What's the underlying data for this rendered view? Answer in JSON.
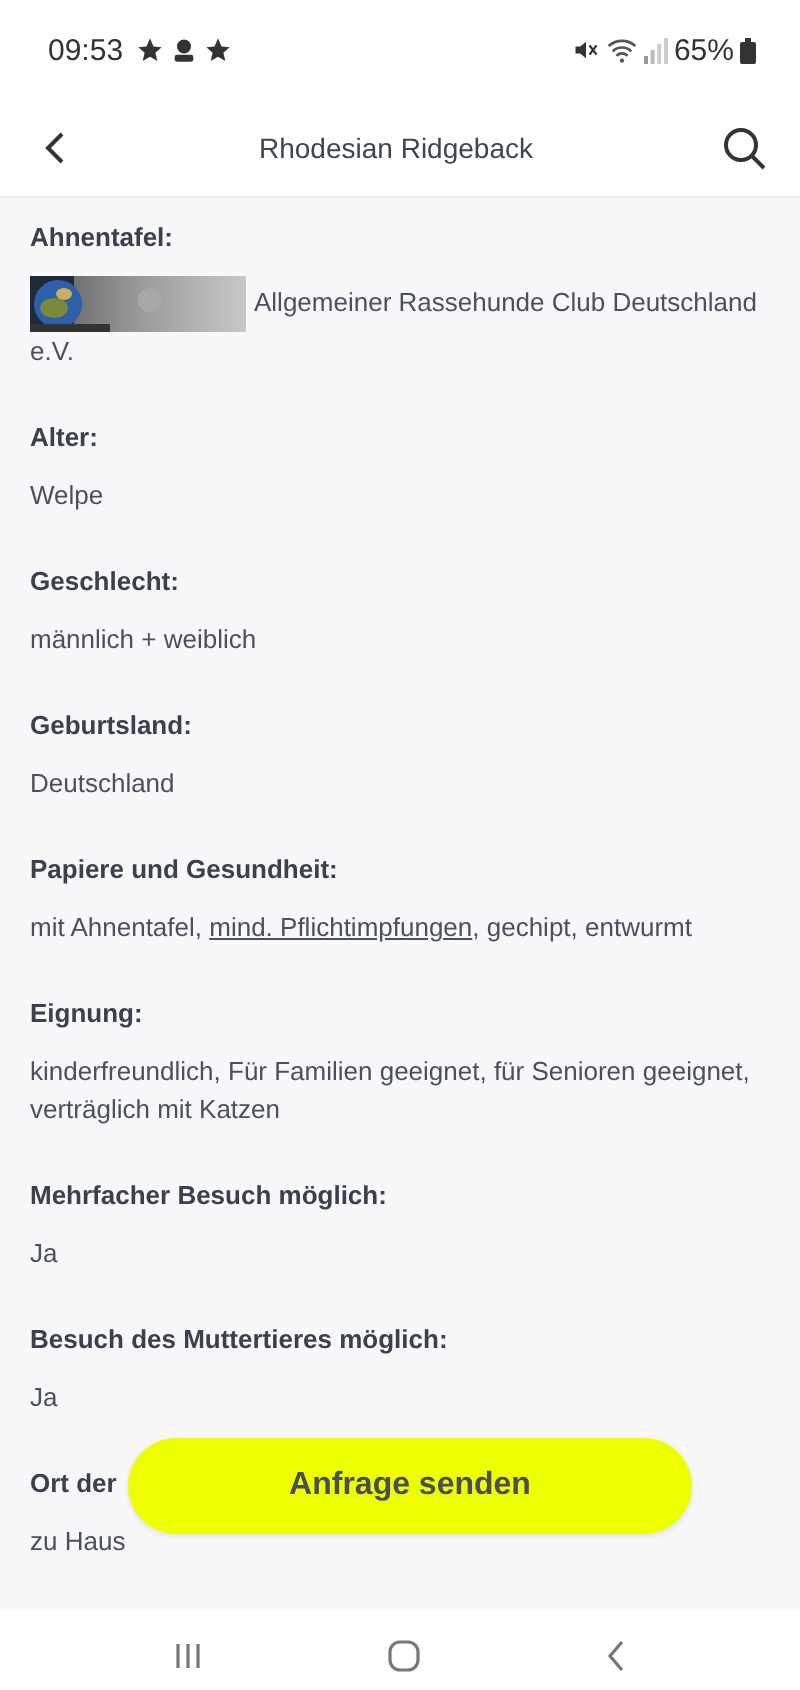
{
  "status_bar": {
    "time": "09:53",
    "battery": "65%"
  },
  "header": {
    "title": "Rhodesian Ridgeback"
  },
  "sections": [
    {
      "label": "Ahnentafel:",
      "kind": "image_text",
      "value": "Allgemeiner Rassehunde Club Deutschland e.V."
    },
    {
      "label": "Alter:",
      "kind": "text",
      "value": "Welpe"
    },
    {
      "label": "Geschlecht:",
      "kind": "text",
      "value": "männlich + weiblich"
    },
    {
      "label": "Geburtsland:",
      "kind": "text",
      "value": "Deutschland"
    },
    {
      "label": "Papiere und Gesundheit:",
      "kind": "parts",
      "parts": [
        {
          "text": "mit Ahnentafel, ",
          "kind": "text"
        },
        {
          "text": "mind. Pflichtimpfungen",
          "kind": "link"
        },
        {
          "text": ", gechipt, entwurmt",
          "kind": "text"
        }
      ]
    },
    {
      "label": "Eignung:",
      "kind": "text",
      "value": "kinderfreundlich, Für Familien geeignet, für Senioren geeignet, verträglich mit Katzen"
    },
    {
      "label": "Mehrfacher Besuch möglich:",
      "kind": "text",
      "value": "Ja"
    },
    {
      "label": "Besuch des Muttertieres möglich:",
      "kind": "text",
      "value": "Ja"
    },
    {
      "label": "Ort der",
      "kind": "text",
      "value": "zu Haus"
    }
  ],
  "action_button": {
    "label": "Anfrage senden"
  }
}
